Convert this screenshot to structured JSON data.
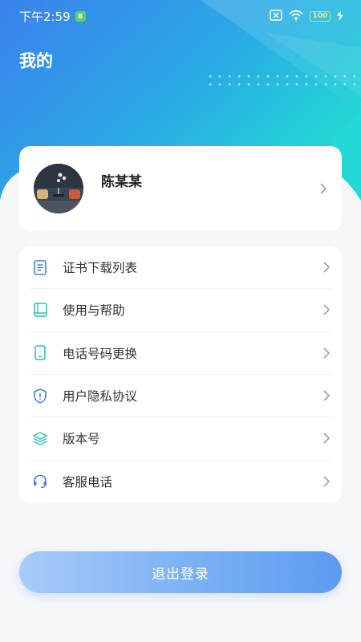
{
  "status_bar": {
    "time": "下午2:59",
    "sim_badge": "B",
    "battery": "100"
  },
  "page": {
    "title": "我的"
  },
  "profile": {
    "name": "陈某某"
  },
  "menu": [
    {
      "label": "证书下载列表",
      "icon": "document-list-icon"
    },
    {
      "label": "使用与帮助",
      "icon": "book-icon"
    },
    {
      "label": "电话号码更换",
      "icon": "phone-icon"
    },
    {
      "label": "用户隐私协议",
      "icon": "shield-icon"
    },
    {
      "label": "版本号",
      "icon": "layers-icon"
    },
    {
      "label": "客服电话",
      "icon": "headset-icon"
    }
  ],
  "logout": {
    "label": "退出登录"
  },
  "colors": {
    "header_gradient_start": "#3a8ef0",
    "header_gradient_end": "#23d6d6",
    "background": "#f4f6f9",
    "icon_blue": "#4a7fd8",
    "icon_teal": "#2fc4b5",
    "logout_start": "#a8cbf8",
    "logout_end": "#5b9cf0"
  }
}
